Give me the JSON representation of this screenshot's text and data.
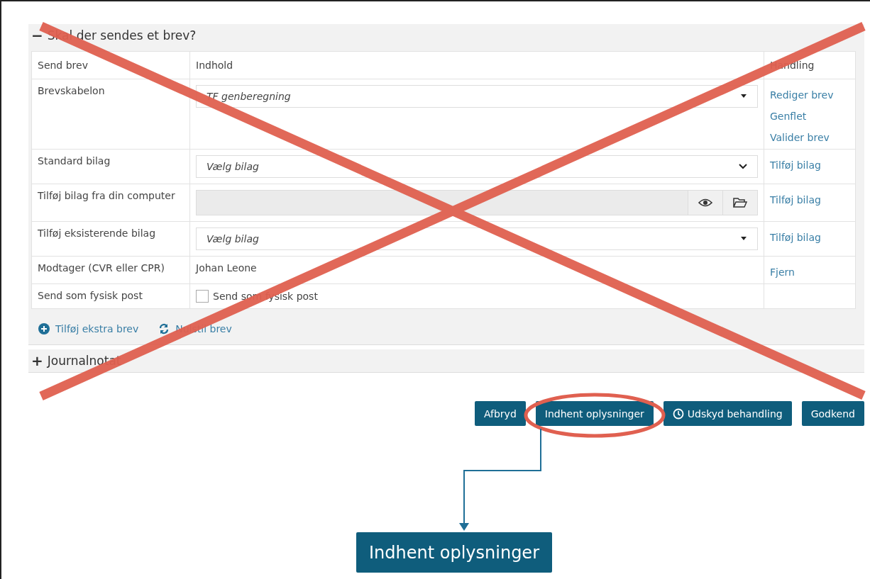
{
  "letter_section": {
    "toggle": "−",
    "title": "Skal der sendes et brev?",
    "expanded": true,
    "columns": [
      "Send brev",
      "Indhold",
      "Handling"
    ],
    "rows": [
      {
        "kind": "combobox",
        "label": "Brevskabelon",
        "value": "TF genberegning",
        "actions": [
          "Rediger brev",
          "Genflet",
          "Valider brev"
        ]
      },
      {
        "kind": "select",
        "label": "Standard bilag",
        "value": "Vælg bilag",
        "actions": [
          "Tilføj bilag"
        ]
      },
      {
        "kind": "file",
        "label": "Tilføj bilag fra din computer",
        "actions": [
          "Tilføj bilag"
        ]
      },
      {
        "kind": "combobox",
        "label": "Tilføj eksisterende bilag",
        "value": "Vælg bilag",
        "actions": [
          "Tilføj bilag"
        ]
      },
      {
        "kind": "text",
        "label": "Modtager (CVR eller CPR)",
        "value": "Johan Leone",
        "actions": [
          "Fjern"
        ]
      },
      {
        "kind": "checkbox",
        "label": "Send som fysisk post",
        "value": "Send som fysisk post",
        "checked": false,
        "actions": []
      }
    ],
    "footer_links": [
      {
        "kind": "add",
        "label": "Tilføj ekstra brev"
      },
      {
        "kind": "reset",
        "label": "Nulstil brev"
      }
    ]
  },
  "journal_section": {
    "toggle": "+",
    "title": "Journalnotat"
  },
  "buttons": [
    {
      "kind": "plain",
      "label": "Afbryd"
    },
    {
      "kind": "plain",
      "label": "Indhent oplysninger"
    },
    {
      "kind": "clock",
      "label": "Udskyd behandling"
    },
    {
      "kind": "plain",
      "label": "Godkend"
    }
  ],
  "callout_button": {
    "label": "Indhent oplysninger"
  },
  "crossed_out": true
}
